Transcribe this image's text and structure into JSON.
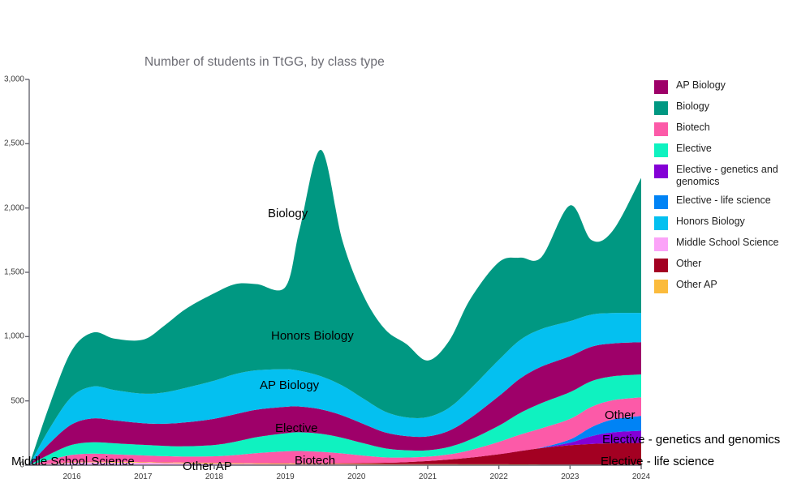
{
  "chart_data": {
    "type": "area",
    "title": "Number of students in TtGG, by class type",
    "xlabel": "",
    "ylabel": "",
    "stacked": true,
    "grid": false,
    "legend_position": "right",
    "xlim": [
      2015.4,
      2024.0
    ],
    "ylim": [
      0,
      3000
    ],
    "yticks": [
      0,
      500,
      1000,
      1500,
      2000,
      2500,
      3000
    ],
    "ytick_labels": [
      "0",
      "500",
      "1,000",
      "1,500",
      "2,000",
      "2,500",
      "3,000"
    ],
    "xticks": [
      2016,
      2017,
      2018,
      2019,
      2020,
      2021,
      2022,
      2023,
      2024
    ],
    "xtick_labels": [
      "2016",
      "2017",
      "2018",
      "2019",
      "2020",
      "2021",
      "2022",
      "2023",
      "2024"
    ],
    "x": [
      2015.4,
      2015.7,
      2016.0,
      2016.3,
      2016.6,
      2017.0,
      2017.3,
      2017.6,
      2018.0,
      2018.3,
      2018.6,
      2019.0,
      2019.2,
      2019.5,
      2019.8,
      2020.1,
      2020.4,
      2020.7,
      2021.0,
      2021.3,
      2021.6,
      2022.0,
      2022.3,
      2022.6,
      2023.0,
      2023.3,
      2023.6,
      2024.0
    ],
    "stack_order": [
      "Middle School Science",
      "Other AP",
      "Other",
      "Elective - genetics and genomics",
      "Elective - life science",
      "Biotech",
      "Elective",
      "AP Biology",
      "Honors Biology",
      "Biology"
    ],
    "series": [
      {
        "name": "Middle School Science",
        "color": "#fba3f8",
        "values": [
          0,
          10,
          20,
          22,
          20,
          18,
          16,
          14,
          12,
          10,
          9,
          8,
          7,
          6,
          6,
          5,
          5,
          4,
          4,
          4,
          3,
          3,
          3,
          2,
          2,
          2,
          2,
          2
        ]
      },
      {
        "name": "Other AP",
        "color": "#fbbb3c",
        "values": [
          0,
          2,
          4,
          5,
          5,
          5,
          5,
          6,
          6,
          6,
          6,
          6,
          5,
          5,
          5,
          5,
          4,
          4,
          4,
          4,
          4,
          4,
          3,
          3,
          3,
          3,
          3,
          3
        ]
      },
      {
        "name": "Other",
        "color": "#a30022",
        "values": [
          0,
          1,
          1,
          1,
          1,
          1,
          1,
          1,
          1,
          1,
          1,
          2,
          2,
          3,
          4,
          6,
          10,
          16,
          24,
          36,
          52,
          78,
          104,
          128,
          150,
          160,
          165,
          168
        ]
      },
      {
        "name": "Elective - genetics and genomics",
        "color": "#8400d6",
        "values": [
          0,
          0,
          0,
          0,
          0,
          0,
          0,
          0,
          0,
          0,
          0,
          0,
          0,
          0,
          0,
          0,
          0,
          0,
          0,
          0,
          0,
          0,
          0,
          2,
          20,
          60,
          85,
          95
        ]
      },
      {
        "name": "Elective - life science",
        "color": "#0083f5",
        "values": [
          0,
          0,
          0,
          0,
          0,
          0,
          0,
          0,
          0,
          0,
          0,
          0,
          0,
          0,
          0,
          0,
          0,
          0,
          0,
          0,
          0,
          0,
          0,
          2,
          25,
          70,
          100,
          115
        ]
      },
      {
        "name": "Biotech",
        "color": "#fc5aa8",
        "values": [
          0,
          30,
          55,
          62,
          58,
          52,
          48,
          46,
          50,
          62,
          78,
          92,
          96,
          90,
          76,
          58,
          42,
          36,
          34,
          40,
          58,
          96,
          128,
          150,
          160,
          158,
          150,
          145
        ]
      },
      {
        "name": "Elective",
        "color": "#0ff2c0",
        "values": [
          0,
          45,
          78,
          88,
          86,
          82,
          80,
          80,
          88,
          104,
          124,
          140,
          146,
          140,
          122,
          96,
          70,
          56,
          50,
          58,
          82,
          126,
          168,
          196,
          208,
          200,
          186,
          178
        ]
      },
      {
        "name": "AP Biology",
        "color": "#9e0069",
        "values": [
          0,
          90,
          160,
          186,
          178,
          168,
          172,
          186,
          204,
          214,
          214,
          206,
          200,
          190,
          174,
          150,
          124,
          110,
          108,
          126,
          168,
          230,
          268,
          284,
          280,
          268,
          256,
          250
        ]
      },
      {
        "name": "Honors Biology",
        "color": "#04c0f0",
        "values": [
          0,
          120,
          215,
          248,
          236,
          230,
          244,
          268,
          296,
          312,
          306,
          292,
          278,
          258,
          232,
          196,
          162,
          146,
          150,
          178,
          226,
          282,
          300,
          292,
          272,
          250,
          236,
          228
        ]
      },
      {
        "name": "Biology",
        "color": "#009882",
        "values": [
          0,
          190,
          360,
          420,
          400,
          420,
          520,
          614,
          680,
          700,
          670,
          640,
          1100,
          1760,
          1130,
          800,
          640,
          570,
          440,
          520,
          700,
          760,
          640,
          560,
          900,
          580,
          640,
          1050
        ]
      }
    ],
    "inline_labels": [
      {
        "text": "Biology",
        "x": 330,
        "y": 255
      },
      {
        "text": "Honors Biology",
        "x": 334,
        "y": 406
      },
      {
        "text": "AP Biology",
        "x": 320,
        "y": 467
      },
      {
        "text": "Elective",
        "x": 339,
        "y": 520
      },
      {
        "text": "Biotech",
        "x": 363,
        "y": 560
      },
      {
        "text": "Middle School Science",
        "x": 14,
        "y": 561
      },
      {
        "text": "Other AP",
        "x": 225,
        "y": 567
      },
      {
        "text": "Other",
        "x": 745,
        "y": 504
      },
      {
        "text": "Elective - genetics and genomics",
        "x": 742,
        "y": 534
      },
      {
        "text": "Elective - life science",
        "x": 740,
        "y": 561
      }
    ]
  },
  "legend": {
    "items": [
      {
        "label": "AP Biology",
        "color": "#9e0069"
      },
      {
        "label": "Biology",
        "color": "#009882"
      },
      {
        "label": "Biotech",
        "color": "#fc5aa8"
      },
      {
        "label": "Elective",
        "color": "#0ff2c0"
      },
      {
        "label": "Elective - genetics and genomics",
        "color": "#8400d6"
      },
      {
        "label": "Elective - life science",
        "color": "#0083f5"
      },
      {
        "label": "Honors Biology",
        "color": "#04c0f0"
      },
      {
        "label": "Middle School Science",
        "color": "#fba3f8"
      },
      {
        "label": "Other",
        "color": "#a30022"
      },
      {
        "label": "Other AP",
        "color": "#fbbb3c"
      }
    ]
  },
  "axis_style": {
    "axis_color": "#666670",
    "tick_color": "#666670",
    "title_color": "#6b6b73"
  }
}
